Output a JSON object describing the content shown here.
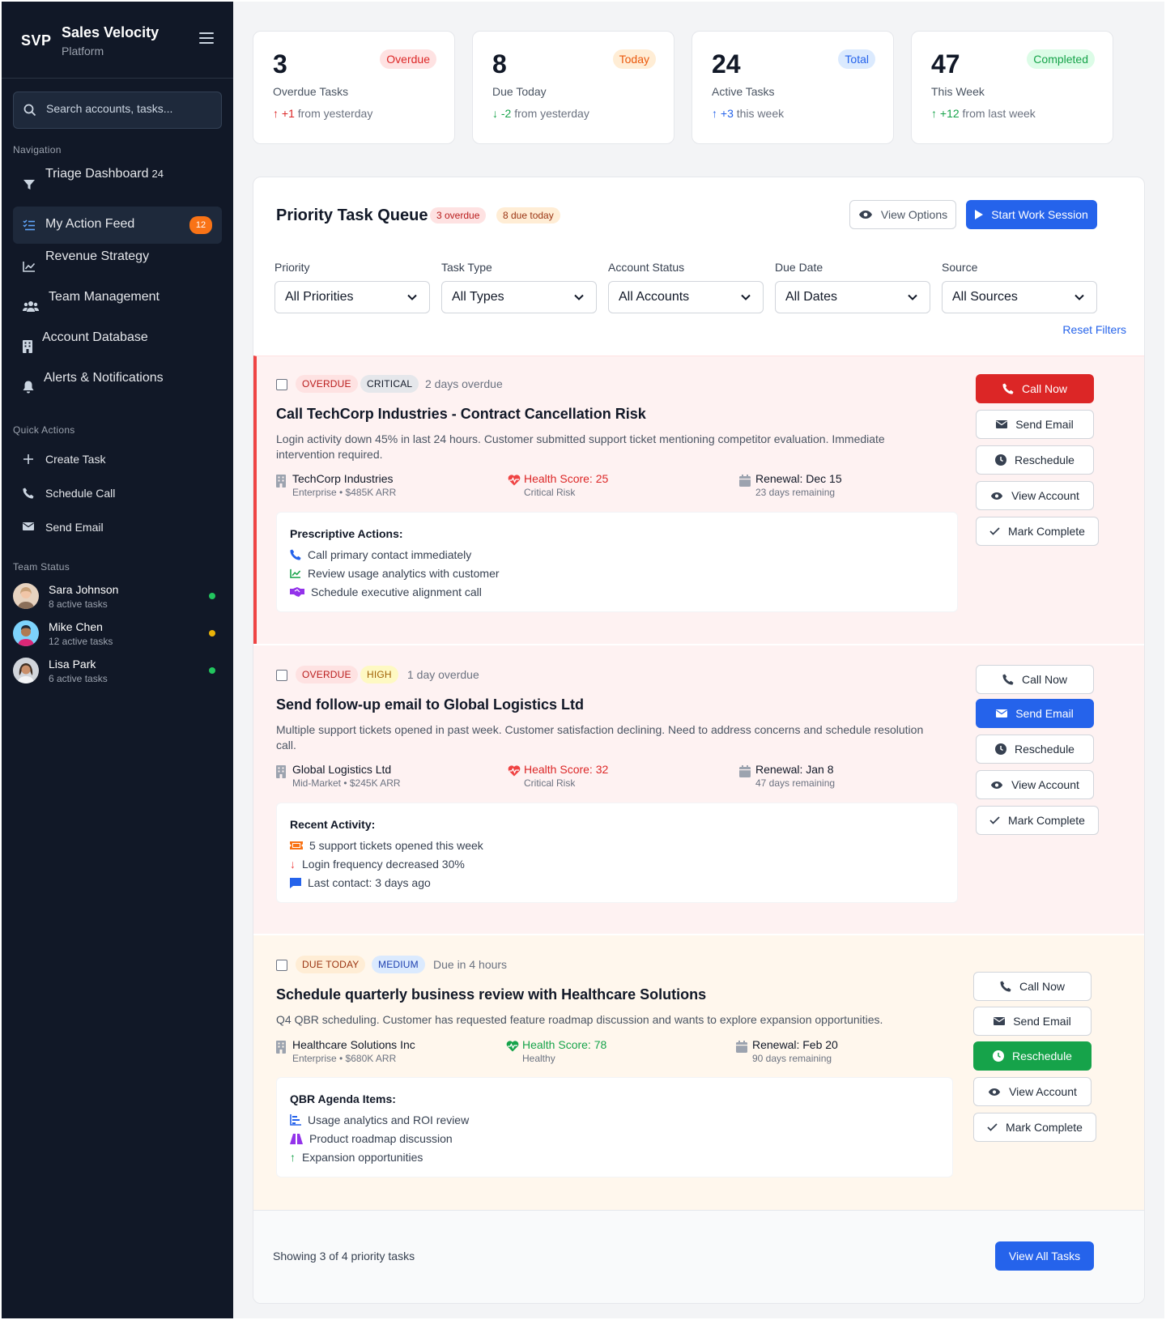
{
  "sidebar": {
    "logo": "SVP",
    "title": "Sales Velocity",
    "subtitle": "Platform",
    "search_placeholder": "Search accounts, tasks...",
    "nav_heading": "Navigation",
    "nav": [
      {
        "label": "Triage Dashboard",
        "count": "24",
        "icon": "filter-icon"
      },
      {
        "label": "My Action Feed",
        "badge": "12",
        "icon": "list-check-icon",
        "active": true
      },
      {
        "label": "Revenue Strategy",
        "icon": "chart-line-icon"
      },
      {
        "label": "Team Management",
        "icon": "users-icon"
      },
      {
        "label": "Account Database",
        "icon": "building-icon"
      },
      {
        "label": "Alerts & Notifications",
        "icon": "bell-icon"
      }
    ],
    "quick_heading": "Quick Actions",
    "quick": [
      {
        "label": "Create Task",
        "icon": "plus-icon"
      },
      {
        "label": "Schedule Call",
        "icon": "phone-icon"
      },
      {
        "label": "Send Email",
        "icon": "envelope-icon"
      }
    ],
    "team_heading": "Team Status",
    "team": [
      {
        "name": "Sara Johnson",
        "tasks": "8 active tasks",
        "status_color": "#22c55e"
      },
      {
        "name": "Mike Chen",
        "tasks": "12 active tasks",
        "status_color": "#eab308"
      },
      {
        "name": "Lisa Park",
        "tasks": "6 active tasks",
        "status_color": "#22c55e"
      }
    ]
  },
  "stats": [
    {
      "number": "3",
      "badge": "Overdue",
      "label": "Overdue Tasks",
      "delta": "+1",
      "delta_text": "from yesterday",
      "color": "#dc2626",
      "badge_bg": "#fee2e2",
      "arrow": "up"
    },
    {
      "number": "8",
      "badge": "Today",
      "label": "Due Today",
      "delta": "-2",
      "delta_text": "from yesterday",
      "color": "#16a34a",
      "badge_bg": "#ffedd5",
      "badge_color": "#ea580c",
      "arrow": "down"
    },
    {
      "number": "24",
      "badge": "Total",
      "label": "Active Tasks",
      "delta": "+3",
      "delta_text": "this week",
      "color": "#2563eb",
      "badge_bg": "#dbeafe",
      "arrow": "up"
    },
    {
      "number": "47",
      "badge": "Completed",
      "label": "This Week",
      "delta": "+12",
      "delta_text": "from last week",
      "color": "#16a34a",
      "badge_bg": "#dcfce7",
      "arrow": "up"
    }
  ],
  "queue": {
    "title": "Priority Task Queue",
    "overdue_pill": "3 overdue",
    "due_pill": "8 due today",
    "view_options": "View Options",
    "start_session": "Start Work Session",
    "filters": [
      {
        "label": "Priority",
        "value": "All Priorities"
      },
      {
        "label": "Task Type",
        "value": "All Types"
      },
      {
        "label": "Account Status",
        "value": "All Accounts"
      },
      {
        "label": "Due Date",
        "value": "All Dates"
      },
      {
        "label": "Source",
        "value": "All Sources"
      }
    ],
    "reset": "Reset Filters"
  },
  "tasks": [
    {
      "status": "OVERDUE",
      "priority": "CRITICAL",
      "when": "2 days overdue",
      "title": "Call TechCorp Industries - Contract Cancellation Risk",
      "desc": "Login activity down 45% in last 24 hours. Customer submitted support ticket mentioning competitor evaluation. Immediate intervention required.",
      "account": "TechCorp Industries",
      "account_meta": "Enterprise • $485K ARR",
      "health": "Health Score: 25",
      "health_meta": "Critical Risk",
      "renewal": "Renewal: Dec 15",
      "renewal_meta": "23 days remaining",
      "box_title": "Prescriptive Actions:",
      "items": [
        "Call primary contact immediately",
        "Review usage analytics with customer",
        "Schedule executive alignment call"
      ],
      "actions": [
        "Call Now",
        "Send Email",
        "Reschedule",
        "View Account",
        "Mark Complete"
      ]
    },
    {
      "status": "OVERDUE",
      "priority": "HIGH",
      "when": "1 day overdue",
      "title": "Send follow-up email to Global Logistics Ltd",
      "desc": "Multiple support tickets opened in past week. Customer satisfaction declining. Need to address concerns and schedule resolution call.",
      "account": "Global Logistics Ltd",
      "account_meta": "Mid-Market • $245K ARR",
      "health": "Health Score: 32",
      "health_meta": "Critical Risk",
      "renewal": "Renewal: Jan 8",
      "renewal_meta": "47 days remaining",
      "box_title": "Recent Activity:",
      "items": [
        "5 support tickets opened this week",
        "Login frequency decreased 30%",
        "Last contact: 3 days ago"
      ],
      "actions": [
        "Call Now",
        "Send Email",
        "Reschedule",
        "View Account",
        "Mark Complete"
      ]
    },
    {
      "status": "DUE TODAY",
      "priority": "MEDIUM",
      "when": "Due in 4 hours",
      "title": "Schedule quarterly business review with Healthcare Solutions",
      "desc": "Q4 QBR scheduling. Customer has requested feature roadmap discussion and wants to explore expansion opportunities.",
      "account": "Healthcare Solutions Inc",
      "account_meta": "Enterprise • $680K ARR",
      "health": "Health Score: 78",
      "health_meta": "Healthy",
      "renewal": "Renewal: Feb 20",
      "renewal_meta": "90 days remaining",
      "box_title": "QBR Agenda Items:",
      "items": [
        "Usage analytics and ROI review",
        "Product roadmap discussion",
        "Expansion opportunities"
      ],
      "actions": [
        "Call Now",
        "Send Email",
        "Reschedule",
        "View Account",
        "Mark Complete"
      ]
    }
  ],
  "footer": {
    "text": "Showing 3 of 4 priority tasks",
    "button": "View All Tasks"
  }
}
